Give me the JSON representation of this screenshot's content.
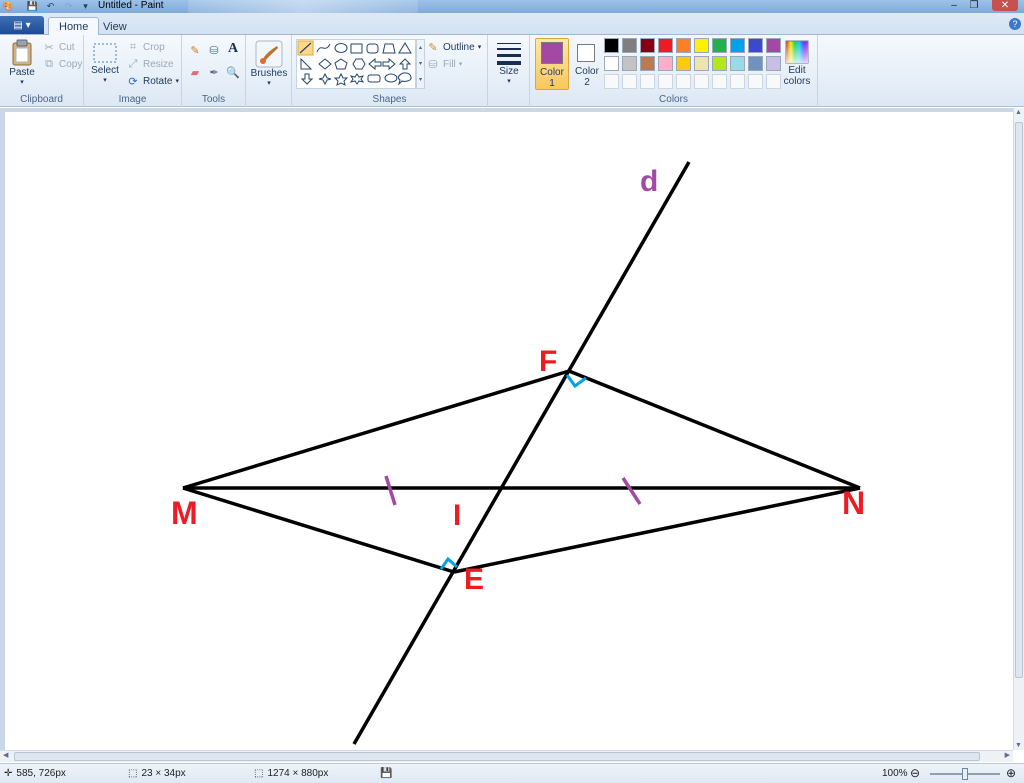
{
  "window": {
    "title": "Untitled - Paint"
  },
  "tabs": [
    {
      "label": "Home",
      "active": true
    },
    {
      "label": "View",
      "active": false
    }
  ],
  "ribbon": {
    "clipboard": {
      "label": "Clipboard",
      "paste": "Paste",
      "cut": "Cut",
      "copy": "Copy"
    },
    "image": {
      "label": "Image",
      "select": "Select",
      "crop": "Crop",
      "resize": "Resize",
      "rotate": "Rotate"
    },
    "tools": {
      "label": "Tools"
    },
    "brushes": {
      "label": "Brushes"
    },
    "shapes": {
      "label": "Shapes",
      "outline": "Outline",
      "fill": "Fill"
    },
    "size": {
      "label": "Size"
    },
    "colors": {
      "label": "Colors",
      "color1": "Color\n1",
      "color1_line1": "Color",
      "color1_line2": "1",
      "color2_line1": "Color",
      "color2_line2": "2",
      "color1_value": "#a349a4",
      "color2_value": "#ffffff",
      "edit": "Edit colors",
      "edit_line1": "Edit",
      "edit_line2": "colors",
      "palette_row1": [
        "#000000",
        "#7f7f7f",
        "#880015",
        "#ed1c24",
        "#ff7f27",
        "#fff200",
        "#22b14c",
        "#00a2e8",
        "#3f48cc",
        "#a349a4"
      ],
      "palette_row2": [
        "#ffffff",
        "#c3c3c3",
        "#b97a57",
        "#ffaec9",
        "#ffc90e",
        "#efe4b0",
        "#b5e61d",
        "#99d9ea",
        "#7092be",
        "#c8bfe7"
      ]
    }
  },
  "drawing": {
    "label_d": "d",
    "label_F": "F",
    "label_M": "M",
    "label_I": "I",
    "label_E": "E",
    "label_N": "N",
    "line_color": "#000000",
    "label_red": "#ed1c24",
    "label_purple": "#a349a4",
    "tick_purple": "#a349a4",
    "right_angle_blue": "#00a2e8"
  },
  "status": {
    "cursor": "585, 726px",
    "selection": "23 × 34px",
    "canvas_size": "1274 × 880px",
    "zoom": "100%"
  }
}
